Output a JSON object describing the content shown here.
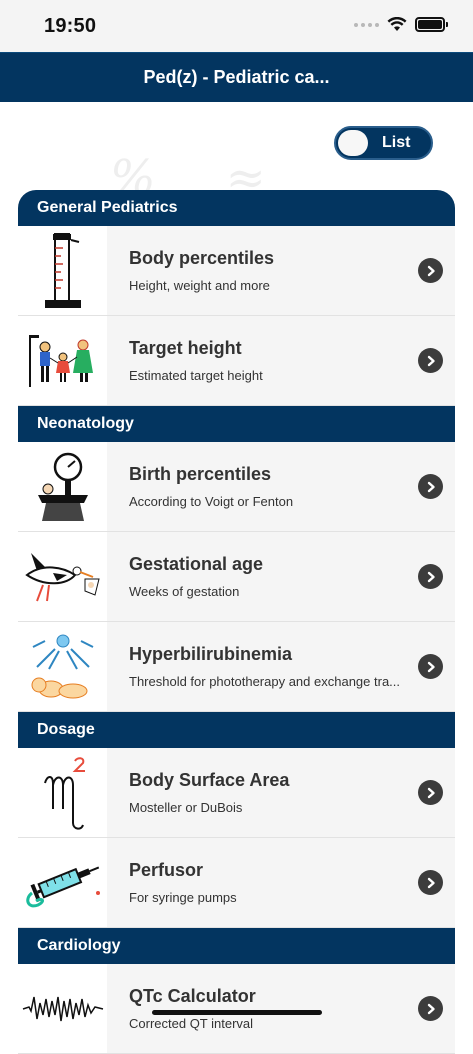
{
  "status_bar": {
    "time": "19:50"
  },
  "nav": {
    "title": "Ped(z) - Pediatric ca..."
  },
  "toggle": {
    "label": "List",
    "state": "off"
  },
  "sections": [
    {
      "title": "General Pediatrics",
      "items": [
        {
          "title": "Body percentiles",
          "subtitle": "Height, weight and more",
          "icon": "measuring-rod-icon"
        },
        {
          "title": "Target height",
          "subtitle": "Estimated target height",
          "icon": "family-icon"
        }
      ]
    },
    {
      "title": "Neonatology",
      "items": [
        {
          "title": "Birth percentiles",
          "subtitle": "According to Voigt or Fenton",
          "icon": "baby-scale-icon"
        },
        {
          "title": "Gestational age",
          "subtitle": "Weeks of gestation",
          "icon": "stork-icon"
        },
        {
          "title": "Hyperbilirubinemia",
          "subtitle": "Threshold for phototherapy and exchange tra...",
          "icon": "phototherapy-icon"
        }
      ]
    },
    {
      "title": "Dosage",
      "items": [
        {
          "title": "Body Surface Area",
          "subtitle": "Mosteller or DuBois",
          "icon": "m-squared-icon"
        },
        {
          "title": "Perfusor",
          "subtitle": "For syringe pumps",
          "icon": "syringe-icon"
        }
      ]
    },
    {
      "title": "Cardiology",
      "items": [
        {
          "title": "QTc Calculator",
          "subtitle": "Corrected QT interval",
          "icon": "ecg-icon"
        }
      ]
    }
  ]
}
